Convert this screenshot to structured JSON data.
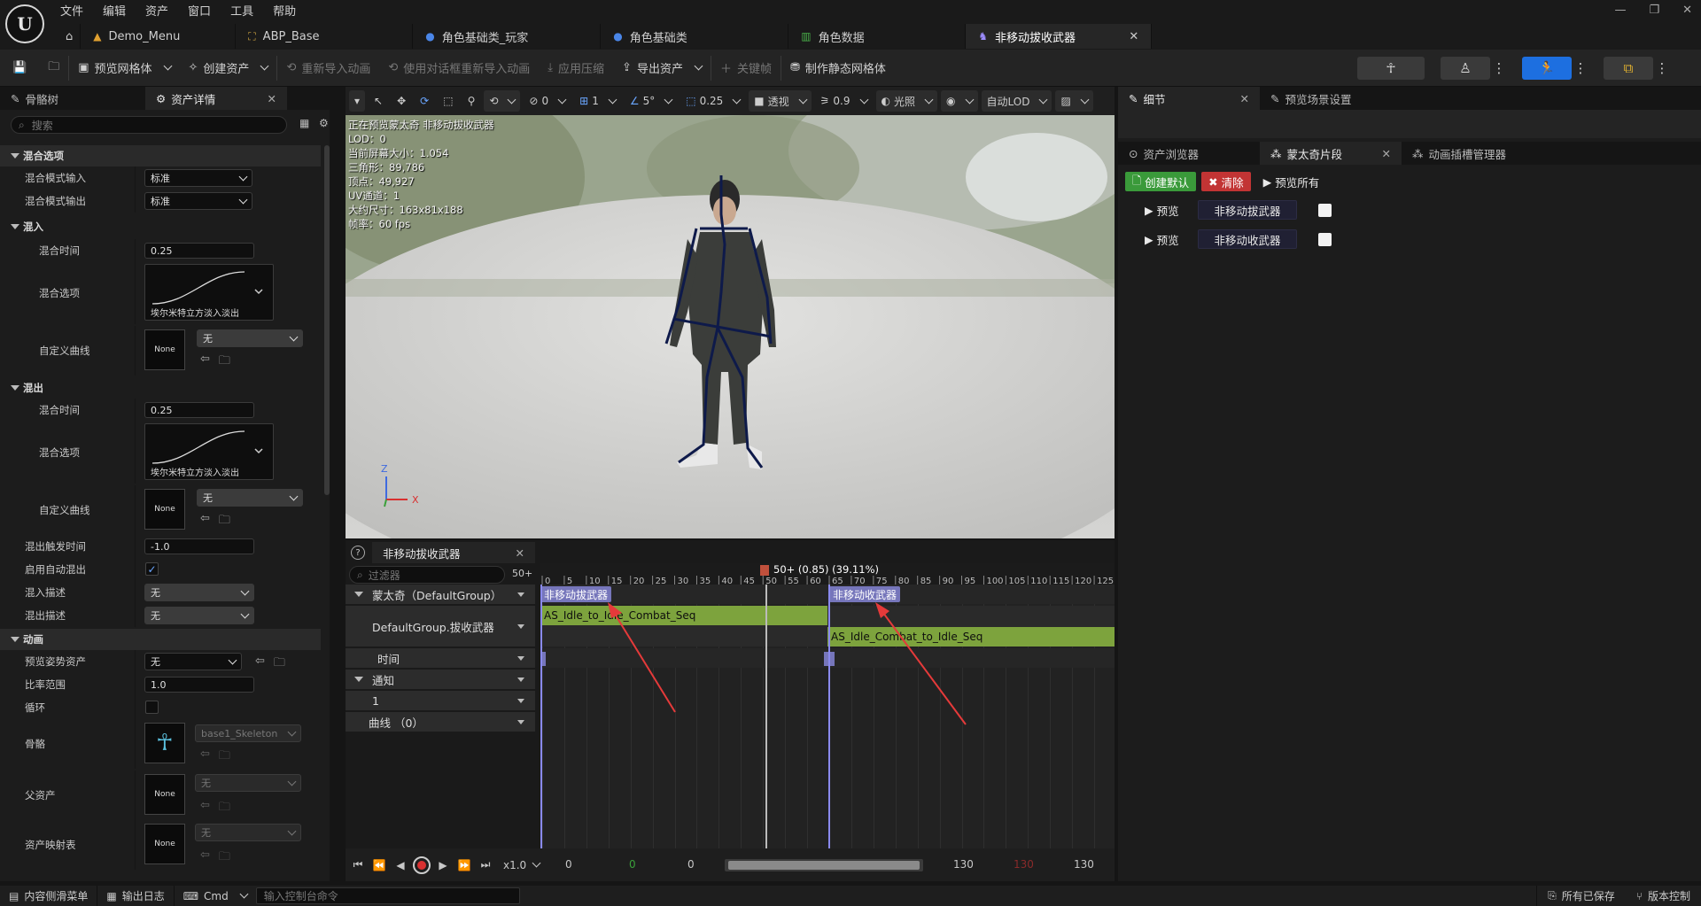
{
  "menu": [
    "文件",
    "编辑",
    "资产",
    "窗口",
    "工具",
    "帮助"
  ],
  "tabs": [
    {
      "label": "Demo_Menu",
      "icon": "level-icon"
    },
    {
      "label": "ABP_Base",
      "icon": "anim-blueprint-icon"
    },
    {
      "label": "角色基础类_玩家",
      "icon": "blueprint-icon"
    },
    {
      "label": "角色基础类",
      "icon": "blueprint-icon"
    },
    {
      "label": "角色数据",
      "icon": "datatable-icon"
    },
    {
      "label": "非移动拔收武器",
      "icon": "montage-icon",
      "active": true
    }
  ],
  "toolbar": {
    "preview_mesh": "预览网格体",
    "create_asset": "创建资产",
    "reimport": "重新导入动画",
    "reimport_dialog": "使用对话框重新导入动画",
    "apply_compression": "应用压缩",
    "export_asset": "导出资产",
    "keyframe": "关键帧",
    "make_static_mesh": "制作静态网格体"
  },
  "left_panel": {
    "tab_skeleton": "骨骼树",
    "tab_details": "资产详情",
    "search_placeholder": "搜索",
    "cat_blend_options": "混合选项",
    "blend_mode_in": "混合模式输入",
    "blend_mode_in_val": "标准",
    "blend_mode_out": "混合模式输出",
    "blend_mode_out_val": "标准",
    "cat_blend_in": "混入",
    "blend_time": "混合时间",
    "blend_in_time": "0.25",
    "blend_option": "混合选项",
    "curve_name": "埃尔米特立方淡入淡出",
    "custom_curve": "自定义曲线",
    "none_thumb": "None",
    "none_sel": "无",
    "cat_blend_out": "混出",
    "blend_out_time": "0.25",
    "blend_out_trigger": "混出触发时间",
    "blend_out_trigger_val": "-1.0",
    "auto_blend_out": "启用自动混出",
    "blend_in_profile": "混入描述",
    "blend_out_profile": "混出描述",
    "cat_animation": "动画",
    "preview_pose": "预览姿势资产",
    "rate_scale": "比率范围",
    "rate_scale_val": "1.0",
    "loop": "循环",
    "skeleton": "骨骼",
    "skeleton_val": "base1_Skeleton",
    "parent_asset": "父资产",
    "asset_mapping": "资产映射表"
  },
  "viewport": {
    "perspective": "透视",
    "lit": "光照",
    "auto_lod": "自动LOD",
    "snap_angle": "5°",
    "snap_scale": "0.25",
    "grid": "1",
    "speed": "0.9",
    "zero": "0",
    "stats": [
      "正在预览蒙太奇 非移动拔收武器",
      "LOD：0",
      "当前屏幕大小：1.054",
      "三角形：89,786",
      "顶点：49,927",
      "UV通道：1",
      "大约尺寸：163x81x188",
      "帧率：60 fps"
    ]
  },
  "montage": {
    "tab": "非移动拔收武器",
    "filter_placeholder": "过滤器",
    "frame_count": "50+",
    "playhead_label": "50+ (0.85) (39.11%)",
    "ticks": [
      "0",
      "5",
      "10",
      "15",
      "20",
      "25",
      "30",
      "35",
      "40",
      "45",
      "50",
      "55",
      "60",
      "65",
      "70",
      "75",
      "80",
      "85",
      "90",
      "95",
      "100",
      "105",
      "110",
      "115",
      "120",
      "125"
    ],
    "montage_track": "蒙太奇（DefaultGroup）",
    "slot_track": "DefaultGroup.拔收武器",
    "time_track": "时间",
    "notify_track": "通知",
    "notify_1": "1",
    "curves_track": "曲线 （0）",
    "section_a": "非移动拔武器",
    "section_b": "非移动收武器",
    "seq_a": "AS_Idle_to_Idle_Combat_Seq",
    "seq_b": "AS_Idle_Combat_to_Idle_Seq",
    "play_rate": "x1.0",
    "range_start": "0",
    "range_green": "0",
    "range_cur": "0",
    "range_end": "130",
    "range_red": "130",
    "range_total": "130"
  },
  "right_panel": {
    "tab_details": "细节",
    "tab_preview_scene": "预览场景设置",
    "tab_asset_browser": "资产浏览器",
    "tab_montage_sections": "蒙太奇片段",
    "tab_anim_slot": "动画插槽管理器",
    "create_default": "创建默认",
    "clear": "清除",
    "preview_all": "预览所有",
    "preview": "预览",
    "section_a": "非移动拔武器",
    "section_b": "非移动收武器"
  },
  "statusbar": {
    "content_drawer": "内容侧滑菜单",
    "output_log": "输出日志",
    "cmd": "Cmd",
    "console_placeholder": "输入控制台命令",
    "all_saved": "所有已保存",
    "source_control": "版本控制"
  },
  "colors": {
    "accent_blue": "#1d6fe0",
    "green_btn": "#3a9a3a",
    "red_btn": "#c23434",
    "segment_green": "#7da33d",
    "section_purple": "#7676bb",
    "arrow_red": "#e53a3a"
  }
}
